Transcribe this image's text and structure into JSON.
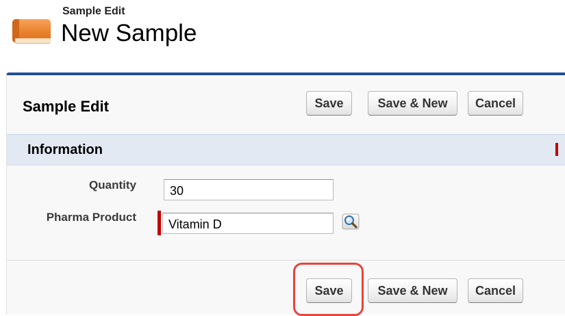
{
  "header": {
    "subtitle": "Sample Edit",
    "title": "New Sample",
    "icon": "sample-book-icon"
  },
  "panel": {
    "title": "Sample Edit",
    "accent_color": "#1f4e9a",
    "buttons": {
      "save": "Save",
      "save_new": "Save & New",
      "cancel": "Cancel"
    }
  },
  "section": {
    "title": "Information"
  },
  "fields": {
    "quantity": {
      "label": "Quantity",
      "value": "30"
    },
    "pharma_product": {
      "label": "Pharma Product",
      "value": "Vitamin D",
      "required": true,
      "lookup_icon": "lookup-magnifier-icon"
    }
  },
  "required_color": "#c00000",
  "highlight_color": "#e8433a"
}
